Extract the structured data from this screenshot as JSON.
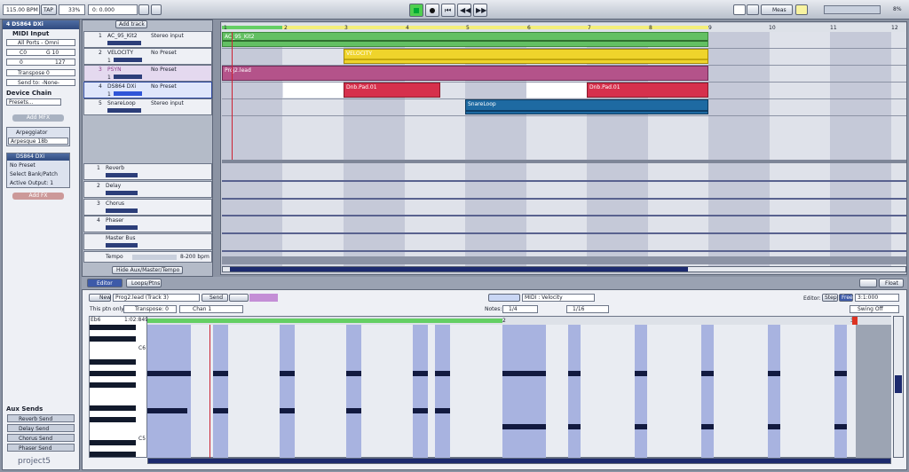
{
  "transport": {
    "tempo": "115.00 BPM",
    "tap": "TAP",
    "cpu": "33%",
    "position": "0:  0.000",
    "meas_label": "Meas",
    "percent": "8%"
  },
  "left": {
    "track_title": "4 DS864 DXi",
    "midi_input": "MIDI Input",
    "all_ports": "All Ports - Omni",
    "ch": "C0",
    "g": "G 10",
    "vel_lo": "0",
    "vel_hi": "127",
    "transpose": "Transpose 0",
    "send_to": "Send to: -None-",
    "device_chain": "Device Chain",
    "presets": "Presets...",
    "add_mfx": "Add MFX",
    "arp": "Arpeggiator",
    "arp_preset": "Arpesque 18b",
    "device": "DS864 DXi",
    "no_preset": "No Preset",
    "bank": "Select Bank/Patch",
    "output": "Active Output: 1",
    "add_fx": "Add FX",
    "aux_sends": "Aux Sends",
    "sends": [
      "Reverb Send",
      "Delay Send",
      "Chorus Send",
      "Phaser Send"
    ],
    "logo": "project5"
  },
  "tracklist": {
    "add_track": "Add track",
    "tracks": [
      {
        "n": "1",
        "name": "AC_95_Kit2",
        "preset": "Stereo input"
      },
      {
        "n": "2",
        "name": "VELOCITY",
        "preset": "No Preset",
        "ch": "1"
      },
      {
        "n": "3",
        "name": "PSYN",
        "preset": "No Preset",
        "ch": "1"
      },
      {
        "n": "4",
        "name": "DS864 DXi",
        "preset": "No Preset",
        "ch": "1"
      },
      {
        "n": "5",
        "name": "SnareLoop",
        "preset": "Stereo input"
      }
    ],
    "aux": [
      {
        "n": "1",
        "name": "Reverb"
      },
      {
        "n": "2",
        "name": "Delay"
      },
      {
        "n": "3",
        "name": "Chorus"
      },
      {
        "n": "4",
        "name": "Phaser"
      },
      {
        "n": "",
        "name": "Master Bus"
      }
    ],
    "tempo": "Tempo",
    "tempo_range": "8-200 bpm",
    "hide_aux": "Hide Aux/Master/Tempo"
  },
  "ruler": [
    "1",
    "2",
    "3",
    "4",
    "5",
    "6",
    "7",
    "8",
    "9",
    "10",
    "11",
    "12"
  ],
  "clips": {
    "ac": "AC_95_Kit2",
    "vel": "VELOCITY",
    "proj": "Proj2.lead",
    "dnb1": "Dnb.Pad.01",
    "dnb2": "Dnb.Pad.01",
    "snare": "SnareLoop"
  },
  "tabs": {
    "editor": "Editor",
    "loops": "Loops/Ptns",
    "float": "Float"
  },
  "editor": {
    "new": "New",
    "pattern": "Prog2.lead (Track 3)",
    "send": "Send",
    "midi": "MIDI : Velocity",
    "editor_label": "Editor:",
    "step": "Step",
    "free": "Free",
    "ratio": "3:1:000",
    "this_ptn": "This ptn only:",
    "transpose": "Transpose: 0",
    "chan": "Chan 1",
    "notes": "Notes:",
    "q1": "1/4",
    "q2": "1/16",
    "swing": "Swing Off",
    "eb6": "Eb6",
    "pos": "1:02:849",
    "c6": "C6",
    "c5": "C5",
    "m2": "2",
    "end": "3"
  }
}
